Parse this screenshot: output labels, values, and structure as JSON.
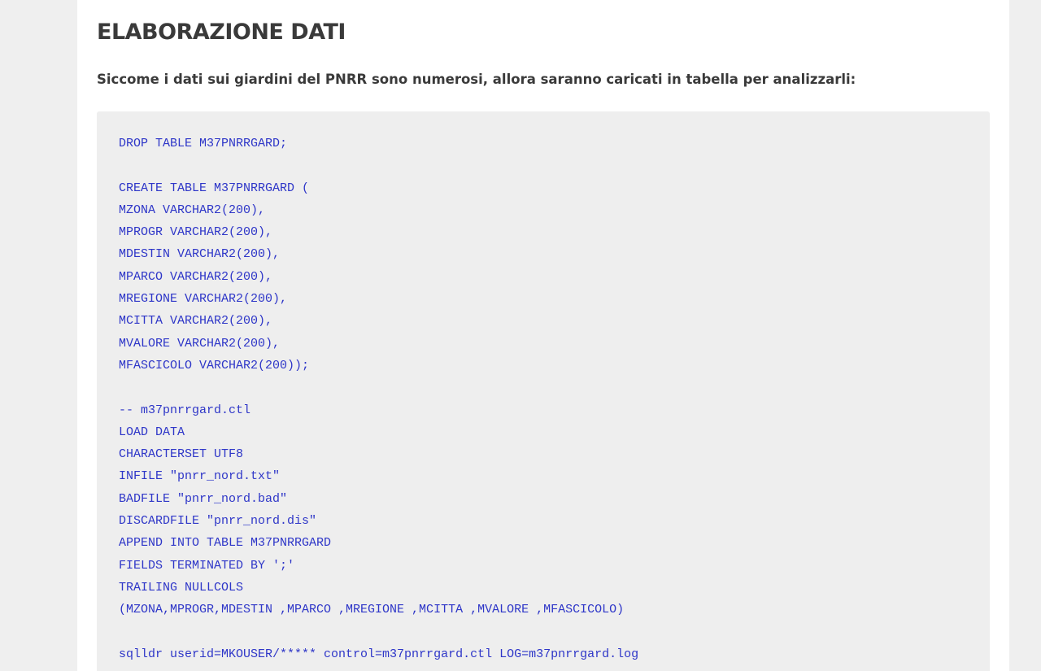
{
  "article": {
    "section_title": "ELABORAZIONE DATI",
    "intro": "Siccome i dati sui giardini del PNRR sono numerosi, allora saranno caricati in tabella per analizzarli:"
  },
  "code_block": {
    "lines": [
      "DROP TABLE M37PNRRGARD;",
      "",
      "CREATE TABLE M37PNRRGARD (",
      "MZONA VARCHAR2(200),",
      "MPROGR VARCHAR2(200),",
      "MDESTIN VARCHAR2(200),",
      "MPARCO VARCHAR2(200),",
      "MREGIONE VARCHAR2(200),",
      "MCITTA VARCHAR2(200),",
      "MVALORE VARCHAR2(200),",
      "MFASCICOLO VARCHAR2(200));",
      "",
      "-- m37pnrrgard.ctl",
      "LOAD DATA",
      "CHARACTERSET UTF8",
      "INFILE \"pnrr_nord.txt\"",
      "BADFILE \"pnrr_nord.bad\"",
      "DISCARDFILE \"pnrr_nord.dis\"",
      "APPEND INTO TABLE M37PNRRGARD",
      "FIELDS TERMINATED BY ';'",
      "TRAILING NULLCOLS",
      "(MZONA,MPROGR,MDESTIN ,MPARCO ,MREGIONE ,MCITTA ,MVALORE ,MFASCICOLO)",
      "",
      "sqlldr userid=MKOUSER/***** control=m37pnrrgard.ctl LOG=m37pnrrgard.log"
    ]
  },
  "colors": {
    "page_background": "#efefef",
    "content_background": "#ffffff",
    "code_background": "#eeeeee",
    "code_text": "#2e36c8",
    "heading_text": "#3a3a3a"
  }
}
